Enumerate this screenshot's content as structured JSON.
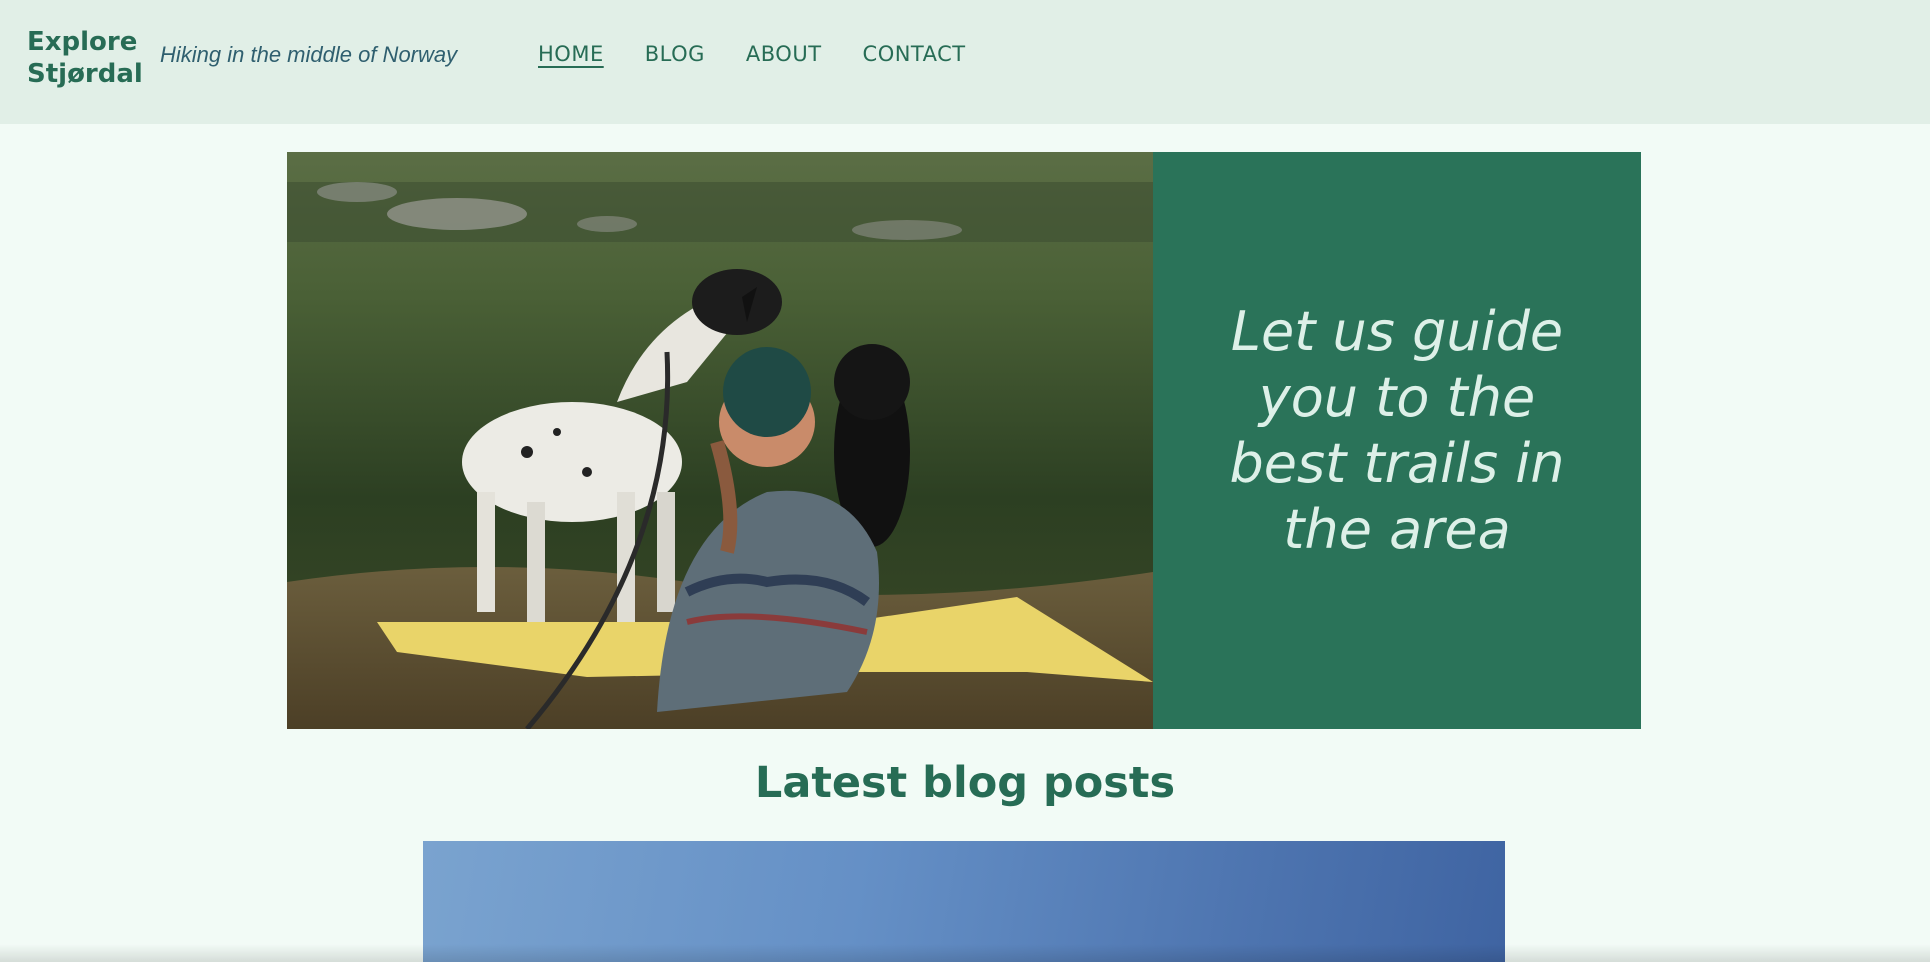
{
  "site": {
    "logo": "Explore Stjørdal",
    "tagline": "Hiking in the middle of Norway"
  },
  "nav": {
    "items": [
      {
        "label": "HOME",
        "active": true
      },
      {
        "label": "BLOG",
        "active": false
      },
      {
        "label": "ABOUT",
        "active": false
      },
      {
        "label": "CONTACT",
        "active": false
      }
    ]
  },
  "hero": {
    "quote": "Let us guide you to the best trails in the area",
    "image_alt": "photo-woman-with-two-dogs-by-lake"
  },
  "blog": {
    "section_title": "Latest blog posts",
    "image_alt": "photo-blue-sky"
  },
  "colors": {
    "header_bg": "#e1efe7",
    "page_bg": "#f2fbf6",
    "brand_green": "#276c55",
    "panel_green": "#2a7359"
  }
}
